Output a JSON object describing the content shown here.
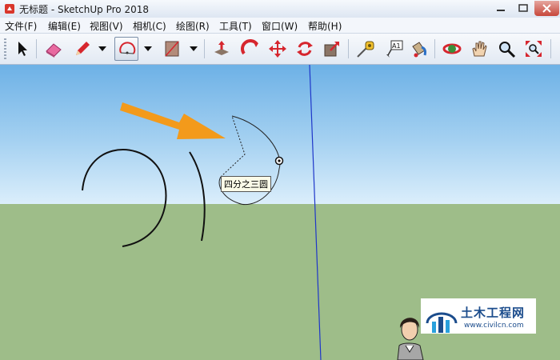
{
  "window": {
    "title": "无标题 - SketchUp Pro 2018"
  },
  "menu": [
    {
      "label": "文件(F)"
    },
    {
      "label": "编辑(E)"
    },
    {
      "label": "视图(V)"
    },
    {
      "label": "相机(C)"
    },
    {
      "label": "绘图(R)"
    },
    {
      "label": "工具(T)"
    },
    {
      "label": "窗口(W)"
    },
    {
      "label": "帮助(H)"
    }
  ],
  "toolbar": {
    "tools": [
      "select-icon",
      "eraser-icon",
      "pencil-icon",
      "arc-icon",
      "rectangle-icon",
      "push-pull-icon",
      "follow-me-icon",
      "move-icon",
      "rotate-icon",
      "scale-icon",
      "tape-measure-icon",
      "text-icon",
      "paint-bucket-icon",
      "orbit-icon",
      "pan-icon",
      "zoom-icon",
      "zoom-extents-icon"
    ],
    "active_tool": "arc-icon",
    "text_tool_glyph": "A1"
  },
  "canvas": {
    "tooltip": "四分之三圆",
    "sky_color": "#8fc4ee",
    "ground_color": "#9ebd89",
    "arrow_color": "#f39a1b"
  },
  "watermark": {
    "name": "土木工程网",
    "url": "www.civilcn.com"
  }
}
